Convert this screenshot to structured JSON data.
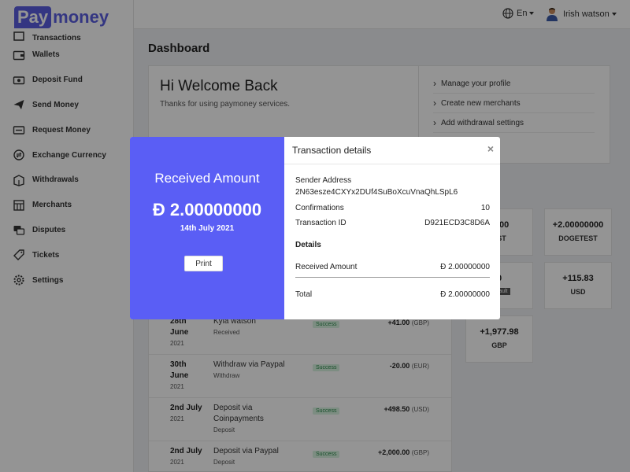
{
  "brand": {
    "pay": "Pay",
    "money": "money"
  },
  "topbar": {
    "language": "En",
    "user_name": "Irish watson"
  },
  "sidebar": {
    "items": [
      {
        "label": "Transactions",
        "icon": "transactions-icon"
      },
      {
        "label": "Wallets",
        "icon": "wallet-icon"
      },
      {
        "label": "Deposit Fund",
        "icon": "deposit-icon"
      },
      {
        "label": "Send Money",
        "icon": "send-icon"
      },
      {
        "label": "Request Money",
        "icon": "request-icon"
      },
      {
        "label": "Exchange Currency",
        "icon": "exchange-icon"
      },
      {
        "label": "Withdrawals",
        "icon": "withdrawals-icon"
      },
      {
        "label": "Merchants",
        "icon": "merchants-icon"
      },
      {
        "label": "Disputes",
        "icon": "disputes-icon"
      },
      {
        "label": "Tickets",
        "icon": "tickets-icon"
      },
      {
        "label": "Settings",
        "icon": "settings-icon"
      }
    ]
  },
  "dashboard": {
    "title": "Dashboard",
    "welcome_title": "Hi Welcome Back",
    "welcome_sub": "Thanks for using paymoney services.",
    "quick_links": [
      "Manage your profile",
      "Create new merchants",
      "Add withdrawal settings"
    ]
  },
  "balances": [
    {
      "amount": "0000",
      "currency": "EST"
    },
    {
      "amount": "+2.00000000",
      "currency": "DOGETEST"
    },
    {
      "amount": "0",
      "currency": "",
      "badge": "default"
    },
    {
      "amount": "+115.83",
      "currency": "USD"
    },
    {
      "amount": "+1,977.98",
      "currency": "GBP"
    }
  ],
  "transactions": [
    {
      "day": "28th",
      "month": "June",
      "year": "2021",
      "desc": "Kyla watson",
      "sub": "Received",
      "status": "Success",
      "amount": "+41.00",
      "unit": "(GBP)"
    },
    {
      "day": "30th",
      "month": "June",
      "year": "2021",
      "desc": "Withdraw via Paypal",
      "sub": "Withdraw",
      "status": "Success",
      "amount": "-20.00",
      "unit": "(EUR)"
    },
    {
      "day": "2nd July",
      "month": "",
      "year": "2021",
      "desc": "Deposit via",
      "desc2": "Coinpayments",
      "sub": "Deposit",
      "status": "Success",
      "amount": "+498.50",
      "unit": "(USD)"
    },
    {
      "day": "2nd July",
      "month": "",
      "year": "2021",
      "desc": "Deposit via Paypal",
      "sub": "Deposit",
      "status": "Success",
      "amount": "+2,000.00",
      "unit": "(GBP)"
    }
  ],
  "modal": {
    "left_title": "Received Amount",
    "left_amount": "Đ 2.00000000",
    "left_date": "14th July 2021",
    "print_label": "Print",
    "title": "Transaction details",
    "close": "×",
    "sender_label": "Sender Address",
    "sender_value": "2N63esze4CXYx2DUf4SuBoXcuVnaQhLSpL6",
    "confirmations_label": "Confirmations",
    "confirmations_value": "10",
    "txid_label": "Transaction ID",
    "txid_value": "D921ECD3C8D6A",
    "details_heading": "Details",
    "received_label": "Received Amount",
    "received_value": "Đ 2.00000000",
    "total_label": "Total",
    "total_value": "Đ 2.00000000"
  },
  "colors": {
    "accent": "#5a5ef5",
    "brand": "#5a5ee0",
    "success_bg": "#d8f3e0"
  }
}
